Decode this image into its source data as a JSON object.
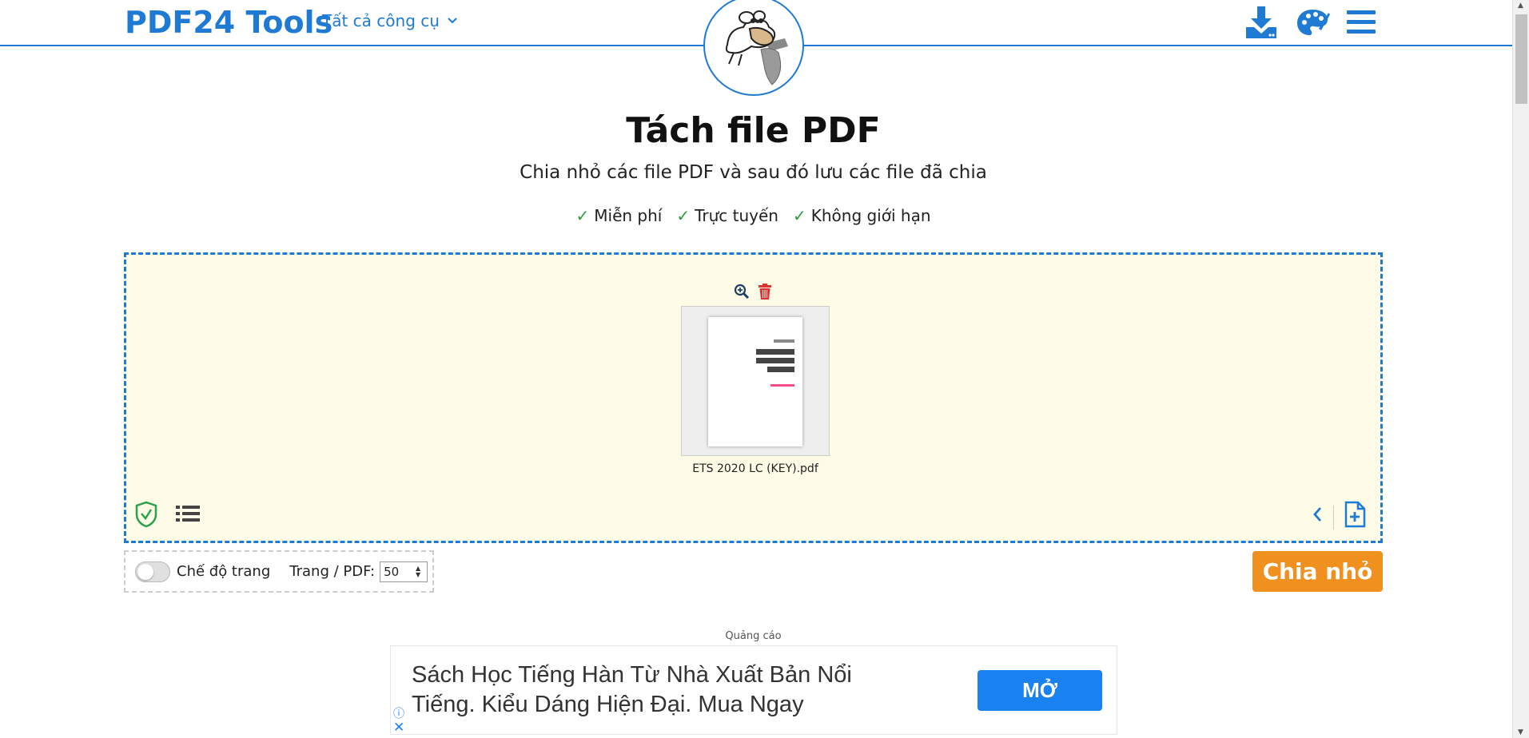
{
  "header": {
    "logo": "PDF24 Tools",
    "all_tools": "Tất cả công cụ"
  },
  "main": {
    "title": "Tách file PDF",
    "subtitle": "Chia nhỏ các file PDF và sau đó lưu các file đã chia",
    "features": [
      "Miễn phí",
      "Trực tuyến",
      "Không giới hạn"
    ]
  },
  "file": {
    "name": "ETS 2020 LC (KEY).pdf"
  },
  "options": {
    "page_mode_label": "Chế độ trang",
    "pages_per_pdf_label": "Trang / PDF:",
    "pages_per_pdf_value": "50",
    "page_mode_on": false
  },
  "actions": {
    "split_label": "Chia nhỏ"
  },
  "ad": {
    "label": "Quảng cáo",
    "text": "Sách Học Tiếng Hàn Từ Nhà Xuất Bản Nổi Tiếng. Kiểu Dáng Hiện Đại. Mua Ngay",
    "button": "MỞ",
    "info": "ⓘ",
    "close": "✕"
  },
  "colors": {
    "brand": "#1e7ad3",
    "action": "#f0901e",
    "dropzone_bg": "#fefbe6",
    "check": "#2a9d3c"
  },
  "icons": [
    "chevron-down-icon",
    "download-icon",
    "palette-icon",
    "menu-icon",
    "zoom-in-icon",
    "trash-icon",
    "shield-check-icon",
    "list-icon",
    "chevron-left-icon",
    "add-file-icon"
  ]
}
